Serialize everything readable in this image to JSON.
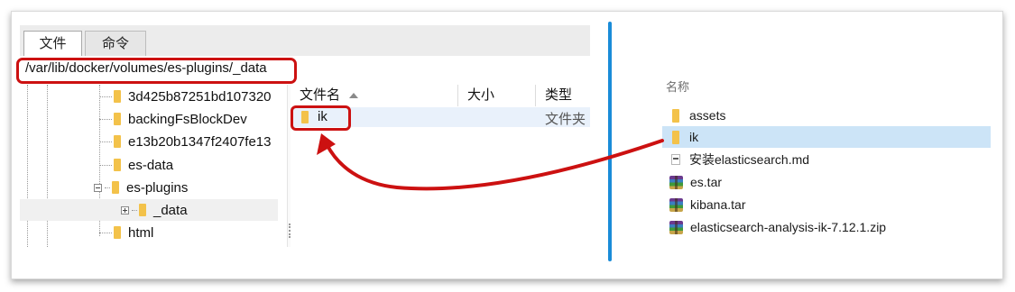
{
  "tabs": [
    {
      "label": "文件",
      "active": true
    },
    {
      "label": "命令",
      "active": false
    }
  ],
  "path": "/var/lib/docker/volumes/es-plugins/_data",
  "tree": {
    "items": [
      {
        "label": "3d425b87251bd107320",
        "kind": "folder"
      },
      {
        "label": "backingFsBlockDev",
        "kind": "folder"
      },
      {
        "label": "e13b20b1347f2407fe13",
        "kind": "folder"
      },
      {
        "label": "es-data",
        "kind": "folder"
      },
      {
        "label": "es-plugins",
        "kind": "folder-expanded"
      },
      {
        "label": "_data",
        "kind": "folder-selected"
      },
      {
        "label": "html",
        "kind": "folder"
      }
    ]
  },
  "filelist": {
    "columns": [
      "文件名",
      "大小",
      "类型"
    ],
    "rows": [
      {
        "name": "ik",
        "size": "",
        "type": "文件夹"
      }
    ]
  },
  "explorer": {
    "header": "名称",
    "items": [
      {
        "label": "assets",
        "icon": "folder-icon"
      },
      {
        "label": "ik",
        "icon": "folder-icon",
        "selected": true
      },
      {
        "label": "安装elasticsearch.md",
        "icon": "markdown-file-icon"
      },
      {
        "label": "es.tar",
        "icon": "archive-icon"
      },
      {
        "label": "kibana.tar",
        "icon": "archive-icon"
      },
      {
        "label": "elasticsearch-analysis-ik-7.12.1.zip",
        "icon": "archive-icon"
      }
    ]
  },
  "colors": {
    "highlight": "#cc1111",
    "divider": "#1a8cd8",
    "selection": "#cce4f7",
    "folder": "#f3c24a"
  }
}
